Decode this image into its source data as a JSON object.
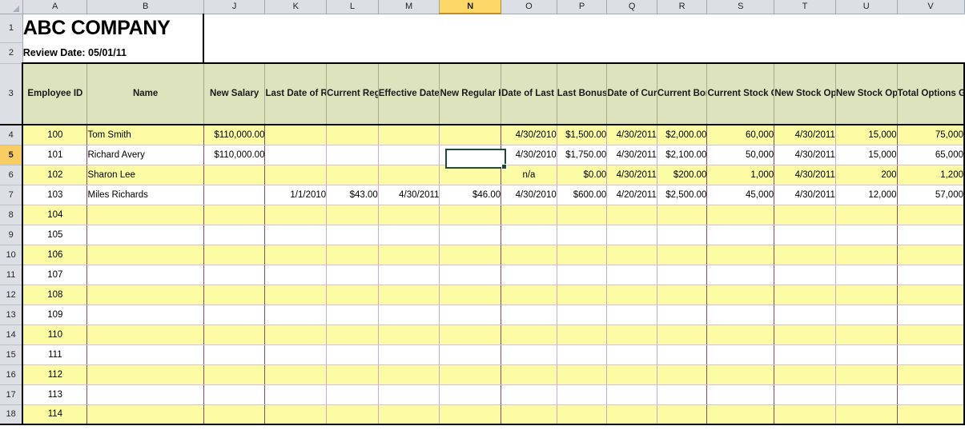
{
  "app": {
    "type": "spreadsheet",
    "select_all_corner": "select-all-triangle"
  },
  "colors": {
    "header_band": "#dce3bd",
    "row_highlight": "#fcfca4",
    "selection_header": "#f8cd63",
    "selected_cell_border": "#1f4a38",
    "column_header_bg": "#dce0e5"
  },
  "column_headers": [
    {
      "letter": "A",
      "selected": false
    },
    {
      "letter": "B",
      "selected": false
    },
    {
      "letter": "J",
      "selected": false
    },
    {
      "letter": "K",
      "selected": false
    },
    {
      "letter": "L",
      "selected": false
    },
    {
      "letter": "M",
      "selected": false
    },
    {
      "letter": "N",
      "selected": true
    },
    {
      "letter": "O",
      "selected": false
    },
    {
      "letter": "P",
      "selected": false
    },
    {
      "letter": "Q",
      "selected": false
    },
    {
      "letter": "R",
      "selected": false
    },
    {
      "letter": "S",
      "selected": false
    },
    {
      "letter": "T",
      "selected": false
    },
    {
      "letter": "U",
      "selected": false
    },
    {
      "letter": "V",
      "selected": false
    }
  ],
  "row_headers": [
    {
      "number": "1",
      "selected": false
    },
    {
      "number": "2",
      "selected": false
    },
    {
      "number": "3",
      "selected": false
    },
    {
      "number": "4",
      "selected": false
    },
    {
      "number": "5",
      "selected": true
    },
    {
      "number": "6",
      "selected": false
    },
    {
      "number": "7",
      "selected": false
    },
    {
      "number": "8",
      "selected": false
    },
    {
      "number": "9",
      "selected": false
    },
    {
      "number": "10",
      "selected": false
    },
    {
      "number": "11",
      "selected": false
    },
    {
      "number": "12",
      "selected": false
    },
    {
      "number": "13",
      "selected": false
    },
    {
      "number": "14",
      "selected": false
    },
    {
      "number": "15",
      "selected": false
    },
    {
      "number": "16",
      "selected": false
    },
    {
      "number": "17",
      "selected": false
    },
    {
      "number": "18",
      "selected": false
    }
  ],
  "title": {
    "company": "ABC COMPANY",
    "review_date_label": "Review Date: 05/01/11"
  },
  "table_headers": [
    "Employee ID",
    "Name",
    "New Salary",
    "Last Date of Regular Hourly Wage",
    "Current Regular Hourly Wage",
    "Effective Date of New Regular Hourly Wage",
    "New Regular Hourly Wage",
    "Date of Last Bonus",
    "Last Bonus Amount",
    "Date of Current Bonus",
    "Current Bonus Amount",
    "Current Stock Options",
    "New Stock Option Grant Date",
    "New Stock Option Grants",
    "Total Options Granted"
  ],
  "selected_cell": {
    "column": "N",
    "row": "5",
    "value": ""
  },
  "rows": [
    {
      "row": "4",
      "band": "yellow",
      "employee_id": "100",
      "name": "Tom Smith",
      "new_salary": "$110,000.00",
      "last_date_hourly": "",
      "current_hourly": "",
      "effective_date_hourly": "",
      "new_hourly": "",
      "date_last_bonus": "4/30/2010",
      "last_bonus_amount": "$1,500.00",
      "date_current_bonus": "4/30/2011",
      "current_bonus_amount": "$2,000.00",
      "current_stock_options": "60,000",
      "new_option_grant_date": "4/30/2011",
      "new_option_grants": "15,000",
      "total_options_granted": "75,000"
    },
    {
      "row": "5",
      "band": "white",
      "employee_id": "101",
      "name": "Richard Avery",
      "new_salary": "$110,000.00",
      "last_date_hourly": "",
      "current_hourly": "",
      "effective_date_hourly": "",
      "new_hourly": "",
      "date_last_bonus": "4/30/2010",
      "last_bonus_amount": "$1,750.00",
      "date_current_bonus": "4/30/2011",
      "current_bonus_amount": "$2,100.00",
      "current_stock_options": "50,000",
      "new_option_grant_date": "4/30/2011",
      "new_option_grants": "15,000",
      "total_options_granted": "65,000"
    },
    {
      "row": "6",
      "band": "yellow",
      "employee_id": "102",
      "name": "Sharon Lee",
      "new_salary": "",
      "last_date_hourly": "",
      "current_hourly": "",
      "effective_date_hourly": "",
      "new_hourly": "",
      "date_last_bonus": "n/a",
      "last_bonus_amount": "$0.00",
      "date_current_bonus": "4/30/2011",
      "current_bonus_amount": "$200.00",
      "current_stock_options": "1,000",
      "new_option_grant_date": "4/30/2011",
      "new_option_grants": "200",
      "total_options_granted": "1,200"
    },
    {
      "row": "7",
      "band": "white",
      "employee_id": "103",
      "name": "Miles Richards",
      "new_salary": "",
      "last_date_hourly": "1/1/2010",
      "current_hourly": "$43.00",
      "effective_date_hourly": "4/30/2011",
      "new_hourly": "$46.00",
      "date_last_bonus": "4/30/2010",
      "last_bonus_amount": "$600.00",
      "date_current_bonus": "4/20/2011",
      "current_bonus_amount": "$2,500.00",
      "current_stock_options": "45,000",
      "new_option_grant_date": "4/30/2011",
      "new_option_grants": "12,000",
      "total_options_granted": "57,000"
    },
    {
      "row": "8",
      "band": "yellow",
      "employee_id": "104",
      "name": "",
      "new_salary": "",
      "last_date_hourly": "",
      "current_hourly": "",
      "effective_date_hourly": "",
      "new_hourly": "",
      "date_last_bonus": "",
      "last_bonus_amount": "",
      "date_current_bonus": "",
      "current_bonus_amount": "",
      "current_stock_options": "",
      "new_option_grant_date": "",
      "new_option_grants": "",
      "total_options_granted": ""
    },
    {
      "row": "9",
      "band": "white",
      "employee_id": "105",
      "name": "",
      "new_salary": "",
      "last_date_hourly": "",
      "current_hourly": "",
      "effective_date_hourly": "",
      "new_hourly": "",
      "date_last_bonus": "",
      "last_bonus_amount": "",
      "date_current_bonus": "",
      "current_bonus_amount": "",
      "current_stock_options": "",
      "new_option_grant_date": "",
      "new_option_grants": "",
      "total_options_granted": ""
    },
    {
      "row": "10",
      "band": "yellow",
      "employee_id": "106",
      "name": "",
      "new_salary": "",
      "last_date_hourly": "",
      "current_hourly": "",
      "effective_date_hourly": "",
      "new_hourly": "",
      "date_last_bonus": "",
      "last_bonus_amount": "",
      "date_current_bonus": "",
      "current_bonus_amount": "",
      "current_stock_options": "",
      "new_option_grant_date": "",
      "new_option_grants": "",
      "total_options_granted": ""
    },
    {
      "row": "11",
      "band": "white",
      "employee_id": "107",
      "name": "",
      "new_salary": "",
      "last_date_hourly": "",
      "current_hourly": "",
      "effective_date_hourly": "",
      "new_hourly": "",
      "date_last_bonus": "",
      "last_bonus_amount": "",
      "date_current_bonus": "",
      "current_bonus_amount": "",
      "current_stock_options": "",
      "new_option_grant_date": "",
      "new_option_grants": "",
      "total_options_granted": ""
    },
    {
      "row": "12",
      "band": "yellow",
      "employee_id": "108",
      "name": "",
      "new_salary": "",
      "last_date_hourly": "",
      "current_hourly": "",
      "effective_date_hourly": "",
      "new_hourly": "",
      "date_last_bonus": "",
      "last_bonus_amount": "",
      "date_current_bonus": "",
      "current_bonus_amount": "",
      "current_stock_options": "",
      "new_option_grant_date": "",
      "new_option_grants": "",
      "total_options_granted": ""
    },
    {
      "row": "13",
      "band": "white",
      "employee_id": "109",
      "name": "",
      "new_salary": "",
      "last_date_hourly": "",
      "current_hourly": "",
      "effective_date_hourly": "",
      "new_hourly": "",
      "date_last_bonus": "",
      "last_bonus_amount": "",
      "date_current_bonus": "",
      "current_bonus_amount": "",
      "current_stock_options": "",
      "new_option_grant_date": "",
      "new_option_grants": "",
      "total_options_granted": ""
    },
    {
      "row": "14",
      "band": "yellow",
      "employee_id": "110",
      "name": "",
      "new_salary": "",
      "last_date_hourly": "",
      "current_hourly": "",
      "effective_date_hourly": "",
      "new_hourly": "",
      "date_last_bonus": "",
      "last_bonus_amount": "",
      "date_current_bonus": "",
      "current_bonus_amount": "",
      "current_stock_options": "",
      "new_option_grant_date": "",
      "new_option_grants": "",
      "total_options_granted": ""
    },
    {
      "row": "15",
      "band": "white",
      "employee_id": "111",
      "name": "",
      "new_salary": "",
      "last_date_hourly": "",
      "current_hourly": "",
      "effective_date_hourly": "",
      "new_hourly": "",
      "date_last_bonus": "",
      "last_bonus_amount": "",
      "date_current_bonus": "",
      "current_bonus_amount": "",
      "current_stock_options": "",
      "new_option_grant_date": "",
      "new_option_grants": "",
      "total_options_granted": ""
    },
    {
      "row": "16",
      "band": "yellow",
      "employee_id": "112",
      "name": "",
      "new_salary": "",
      "last_date_hourly": "",
      "current_hourly": "",
      "effective_date_hourly": "",
      "new_hourly": "",
      "date_last_bonus": "",
      "last_bonus_amount": "",
      "date_current_bonus": "",
      "current_bonus_amount": "",
      "current_stock_options": "",
      "new_option_grant_date": "",
      "new_option_grants": "",
      "total_options_granted": ""
    },
    {
      "row": "17",
      "band": "white",
      "employee_id": "113",
      "name": "",
      "new_salary": "",
      "last_date_hourly": "",
      "current_hourly": "",
      "effective_date_hourly": "",
      "new_hourly": "",
      "date_last_bonus": "",
      "last_bonus_amount": "",
      "date_current_bonus": "",
      "current_bonus_amount": "",
      "current_stock_options": "",
      "new_option_grant_date": "",
      "new_option_grants": "",
      "total_options_granted": ""
    },
    {
      "row": "18",
      "band": "yellow",
      "employee_id": "114",
      "name": "",
      "new_salary": "",
      "last_date_hourly": "",
      "current_hourly": "",
      "effective_date_hourly": "",
      "new_hourly": "",
      "date_last_bonus": "",
      "last_bonus_amount": "",
      "date_current_bonus": "",
      "current_bonus_amount": "",
      "current_stock_options": "",
      "new_option_grant_date": "",
      "new_option_grants": "",
      "total_options_granted": ""
    }
  ]
}
